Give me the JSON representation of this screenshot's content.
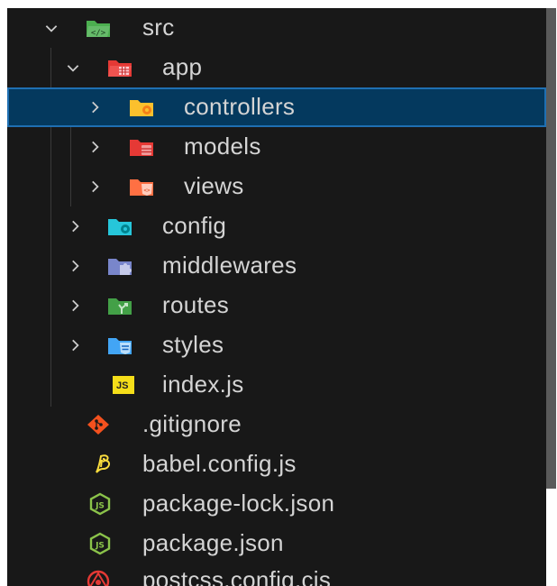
{
  "explorer": {
    "items": [
      {
        "label": "src",
        "icon": "folder-src-open-icon",
        "state": "expanded"
      },
      {
        "label": "app",
        "icon": "folder-app-open-icon",
        "state": "expanded"
      },
      {
        "label": "controllers",
        "icon": "folder-controllers-icon",
        "state": "collapsed",
        "selected": true
      },
      {
        "label": "models",
        "icon": "folder-models-icon",
        "state": "collapsed"
      },
      {
        "label": "views",
        "icon": "folder-views-icon",
        "state": "collapsed"
      },
      {
        "label": "config",
        "icon": "folder-config-icon",
        "state": "collapsed"
      },
      {
        "label": "middlewares",
        "icon": "folder-middlewares-icon",
        "state": "collapsed"
      },
      {
        "label": "routes",
        "icon": "folder-routes-icon",
        "state": "collapsed"
      },
      {
        "label": "styles",
        "icon": "folder-styles-icon",
        "state": "collapsed"
      },
      {
        "label": "index.js",
        "icon": "javascript-file-icon",
        "icon_text": "JS"
      },
      {
        "label": ".gitignore",
        "icon": "git-icon"
      },
      {
        "label": "babel.config.js",
        "icon": "babel-icon"
      },
      {
        "label": "package-lock.json",
        "icon": "nodejs-icon"
      },
      {
        "label": "package.json",
        "icon": "nodejs-icon"
      },
      {
        "label": "postcss.config.cjs",
        "icon": "postcss-icon"
      }
    ]
  },
  "colors": {
    "background": "#181818",
    "selection": "#04395e",
    "selection_border": "#1f6fb2",
    "text": "#d4d4d4"
  }
}
